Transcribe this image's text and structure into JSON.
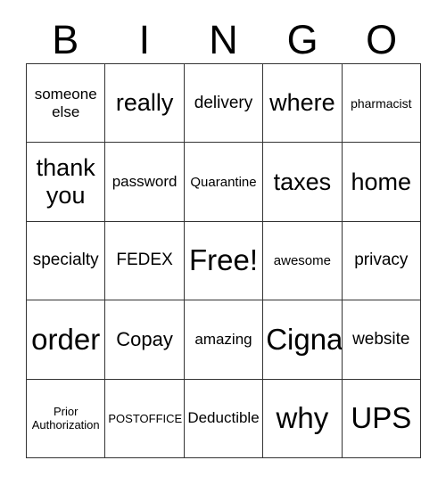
{
  "card": {
    "title": "BINGO",
    "header_letters": [
      "B",
      "I",
      "N",
      "G",
      "O"
    ],
    "colors": {
      "background": "#ffffff",
      "border": "#333333",
      "text": "#000000"
    },
    "grid": {
      "columns": 5,
      "rows": 5,
      "free_space": "Free!"
    },
    "cells": [
      [
        {
          "label": "someone\nelse",
          "size": "sz-m"
        },
        {
          "label": "really",
          "size": "sz-xl"
        },
        {
          "label": "delivery",
          "size": "sz-ml"
        },
        {
          "label": "where",
          "size": "sz-xl"
        },
        {
          "label": "pharmacist",
          "size": "sz-s"
        }
      ],
      [
        {
          "label": "thank\nyou",
          "size": "sz-xl"
        },
        {
          "label": "password",
          "size": "sz-m"
        },
        {
          "label": "Quarantine",
          "size": "sz-sm"
        },
        {
          "label": "taxes",
          "size": "sz-xl"
        },
        {
          "label": "home",
          "size": "sz-xl"
        }
      ],
      [
        {
          "label": "specialty",
          "size": "sz-ml"
        },
        {
          "label": "FEDEX",
          "size": "sz-ml"
        },
        {
          "label": "Free!",
          "size": "sz-xxl"
        },
        {
          "label": "awesome",
          "size": "sz-sm"
        },
        {
          "label": "privacy",
          "size": "sz-ml"
        }
      ],
      [
        {
          "label": "order",
          "size": "sz-xxl"
        },
        {
          "label": "Copay",
          "size": "sz-l"
        },
        {
          "label": "amazing",
          "size": "sz-m"
        },
        {
          "label": "Cigna",
          "size": "sz-xxl"
        },
        {
          "label": "website",
          "size": "sz-ml"
        }
      ],
      [
        {
          "label": "Prior\nAuthorization",
          "size": "sz-xs"
        },
        {
          "label": "POSTOFFICE",
          "size": "sz-xs"
        },
        {
          "label": "Deductible",
          "size": "sz-m"
        },
        {
          "label": "why",
          "size": "sz-xxl"
        },
        {
          "label": "UPS",
          "size": "sz-xxl"
        }
      ]
    ]
  }
}
